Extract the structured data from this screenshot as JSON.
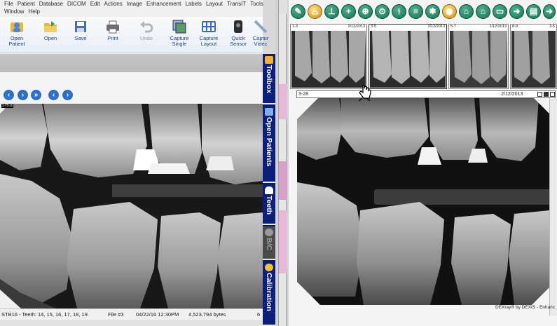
{
  "left_window": {
    "menu_row1": [
      "File",
      "Patient",
      "Database",
      "DICOM",
      "Edit",
      "Actions",
      "Image",
      "Enhancement",
      "Labels",
      "Layout",
      "TransIT",
      "Tools"
    ],
    "menu_row2": [
      "Window",
      "Help"
    ],
    "ribbon": [
      {
        "line1": "Open",
        "line2": "Patient",
        "icon": "open-patient-icon",
        "color": "#4a86d4",
        "disabled": false
      },
      {
        "line1": "Open",
        "line2": "",
        "icon": "folder-icon",
        "color": "#e8b63a",
        "disabled": false
      },
      {
        "line1": "Save",
        "line2": "",
        "icon": "save-icon",
        "color": "#3f6fbf",
        "disabled": false
      },
      {
        "line1": "Print",
        "line2": "",
        "icon": "print-icon",
        "color": "#6f6f6f",
        "disabled": false
      },
      {
        "line1": "Undo",
        "line2": "",
        "icon": "undo-icon",
        "color": "#b5b5b5",
        "disabled": true
      },
      {
        "line1": "Capture",
        "line2": "Single",
        "icon": "capture-single-icon",
        "color": "#5e9a6a",
        "disabled": false
      },
      {
        "line1": "Capture",
        "line2": "Layout",
        "icon": "capture-layout-icon",
        "color": "#3b66c4",
        "disabled": false
      },
      {
        "line1": "Quick",
        "line2": "Sensor",
        "icon": "sensor-icon",
        "color": "#2d2d2d",
        "disabled": false
      },
      {
        "line1": "Captur",
        "line2": "Videc",
        "icon": "video-icon",
        "color": "#8aa6c8",
        "disabled": false
      }
    ],
    "nav_buttons": [
      "first",
      "next",
      "last",
      "prev",
      "next2"
    ],
    "image_label": "STB16",
    "status": {
      "patient": "STB16 - Teeth: 14, 15, 16, 17, 18, 19",
      "file": "File #3",
      "date": "04/22/16 12:30PM",
      "size": "4,523,794 bytes",
      "extra": "6"
    }
  },
  "vertical_tabs": [
    {
      "label": "Toolbox",
      "icon": "wrench-icon",
      "disabled": false
    },
    {
      "label": "Open Patients",
      "icon": "patients-icon",
      "disabled": false
    },
    {
      "label": "Teeth",
      "icon": "tooth-icon",
      "disabled": false
    },
    {
      "label": "B/C",
      "icon": "brightness-icon",
      "disabled": true
    },
    {
      "label": "Calibration",
      "icon": "calibration-icon",
      "disabled": false
    }
  ],
  "right_window": {
    "toolbar_icons": [
      "pen-icon",
      "tooth-icon",
      "stamp-icon",
      "crosshair-icon",
      "zoom-in-icon",
      "zoom-icon",
      "measure-icon",
      "list-icon",
      "brightness-icon",
      "sharpen-icon",
      "tooth-outline-icon",
      "home-icon",
      "folder-open-icon",
      "export-icon",
      "print-icon",
      "export2-icon",
      "logout-icon"
    ],
    "thumbnails": [
      {
        "id": "1-3",
        "date": "2/12/2013"
      },
      {
        "id": "3-5",
        "date": "2/12/2013"
      },
      {
        "id": "5-7",
        "date": "2/12/2013"
      },
      {
        "id": "8-9",
        "date": "3-5"
      }
    ],
    "main_image": {
      "id": "3-28",
      "date": "2/12/2013"
    },
    "footer": "DEXray® by DEXIS - Enhanc"
  },
  "colors": {
    "tab_blue": "#0c1f7a",
    "toolbar_green": "#2a8a68",
    "link_blue": "#1d3f8a"
  }
}
